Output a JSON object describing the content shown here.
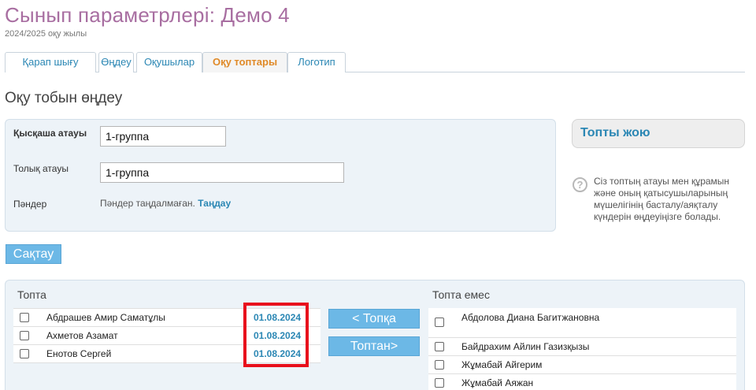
{
  "header": {
    "title": "Сынып параметрлері: Демо 4",
    "subtitle": "2024/2025 оқу жылы"
  },
  "tabs": [
    {
      "label": "Қарап шығу",
      "active": false
    },
    {
      "label": "Өңдеу",
      "active": false
    },
    {
      "label": "Оқушылар",
      "active": false
    },
    {
      "label": "Оқу топтары",
      "active": true
    },
    {
      "label": "Логотип",
      "active": false
    }
  ],
  "section_title": "Оқу тобын өңдеу",
  "form": {
    "short_name_label": "Қысқаша атауы",
    "short_name_value": "1-группа",
    "full_name_label": "Толық атауы",
    "full_name_value": "1-группа",
    "subjects_label": "Пәндер",
    "subjects_hint": "Пәндер таңдалмаған.",
    "subjects_link": "Таңдау"
  },
  "delete_group": {
    "label": "Топты жою"
  },
  "help": {
    "text": "Сіз топтың атауы мен құрамын және оның қатысушыларының мүшелігінің басталу/аяқталу күндерін өңдеуіңізге болады."
  },
  "save_button": "Сақтау",
  "in_group": {
    "title": "Топта",
    "members": [
      {
        "name": "Абдрашев Амир Саматұлы",
        "date": "01.08.2024",
        "checked": false
      },
      {
        "name": "Ахметов Азамат",
        "date": "01.08.2024",
        "checked": false
      },
      {
        "name": "Енотов Сергей",
        "date": "01.08.2024",
        "checked": false
      }
    ]
  },
  "move_buttons": {
    "to_group": "< Топқа",
    "from_group": "Топтан>"
  },
  "not_in_group": {
    "title": "Топта емес",
    "members": [
      {
        "name": "Абдолова Диана Багитжановна",
        "checked": false
      },
      {
        "name": "Байдрахим Айлин Газизқызы",
        "checked": false
      },
      {
        "name": "Жұмабай Айгерим",
        "checked": false
      },
      {
        "name": "Жұмабай Аяжан",
        "checked": false
      }
    ]
  },
  "colors": {
    "title": "#a86ea1",
    "link": "#2b87b4",
    "active_tab": "#e08a28",
    "button": "#6cb8e6",
    "highlight": "#e8101c"
  }
}
